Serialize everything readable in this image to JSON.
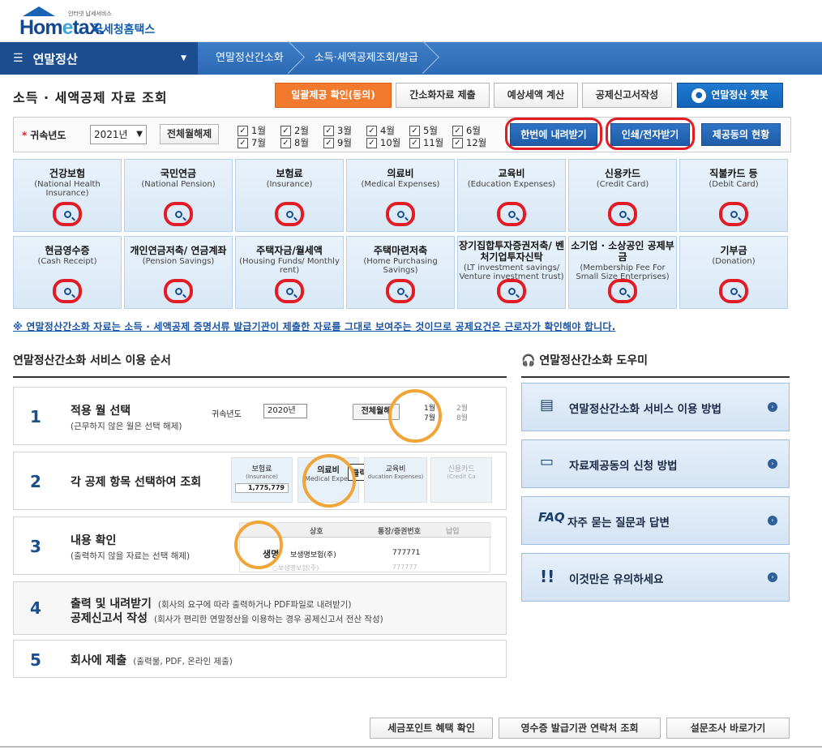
{
  "header": {
    "brand_home": "Hom",
    "brand_e": "e",
    "brand_tax": "tax",
    "tagline": "인터넷 납세서비스",
    "brand_kor": "국세청홈택스"
  },
  "nav": {
    "main": "연말정산",
    "crumbs": [
      "연말정산간소화",
      "소득·세액공제조회/발급"
    ]
  },
  "page": {
    "title": "소득 · 세액공제 자료 조회",
    "top_buttons": [
      "일괄제공 확인(동의)",
      "간소화자료 제출",
      "예상세액 계산",
      "공제신고서작성",
      "연말정산 챗봇"
    ]
  },
  "filter": {
    "year_label": "귀속년도",
    "year_value": "2021년",
    "deselect_all": "전체월해제",
    "months": [
      "1월",
      "2월",
      "3월",
      "4월",
      "5월",
      "6월",
      "7월",
      "8월",
      "9월",
      "10월",
      "11월",
      "12월"
    ],
    "download_all": "한번에 내려받기",
    "print_receive": "인쇄/전자받기",
    "consent_status": "제공동의 현황"
  },
  "categories": [
    {
      "ko": "건강보험",
      "en": "(National Health Insurance)"
    },
    {
      "ko": "국민연금",
      "en": "(National Pension)"
    },
    {
      "ko": "보험료",
      "en": "(Insurance)"
    },
    {
      "ko": "의료비",
      "en": "(Medical Expenses)"
    },
    {
      "ko": "교육비",
      "en": "(Education Expenses)"
    },
    {
      "ko": "신용카드",
      "en": "(Credit Card)"
    },
    {
      "ko": "직불카드 등",
      "en": "(Debit Card)"
    },
    {
      "ko": "현금영수증",
      "en": "(Cash Receipt)"
    },
    {
      "ko": "개인연금저축/ 연금계좌",
      "en": "(Pension Savings)"
    },
    {
      "ko": "주택자금/월세액",
      "en": "(Housing Funds/ Monthly rent)"
    },
    {
      "ko": "주택마련저축",
      "en": "(Home Purchasing Savings)"
    },
    {
      "ko": "장기집합투자증권저축/ 벤처기업투자신탁",
      "en": "(LT investment savings/ Venture investment trust)"
    },
    {
      "ko": "소기업 · 소상공인 공제부금",
      "en": "(Membership Fee For Small Size Enterprises)"
    },
    {
      "ko": "기부금",
      "en": "(Donation)"
    }
  ],
  "notice": "※ 연말정산간소화 자료는 소득 · 세액공제 증명서류 발급기관이 제출한 자료를 그대로 보여주는 것이므로 공제요건은 근로자가 확인해야 합니다.",
  "steps": {
    "title": "연말정산간소화 서비스 이용 순서",
    "items": [
      {
        "num": "1",
        "title": "적용 월 선택",
        "sub": "(근무하지 않은 월은 선택 해제)"
      },
      {
        "num": "2",
        "title": "각 공제 항목 선택하여 조회",
        "sub": ""
      },
      {
        "num": "3",
        "title": "내용 확인",
        "sub": "(출력하지 않을 자료는 선택 해제)"
      },
      {
        "num": "4",
        "title": "출력 및 내려받기",
        "desc": "(회사의 요구에 따라 출력하거나 PDF파일로 내려받기)",
        "title2": "공제신고서 작성",
        "desc2": "(회사가 편리한 연말정산을 이용하는 경우 공제신고서 전산 작성)"
      },
      {
        "num": "5",
        "title": "회사에 제출",
        "desc": "(출력물, PDF, 온라인 제출)"
      }
    ],
    "illus1": {
      "year_label": "귀속년도",
      "year": "2020년",
      "btn": "전체월해",
      "m1": "1월",
      "m2": "2월",
      "m7": "7월",
      "m8": "8월"
    },
    "illus2": {
      "c1": "보험료",
      "c1en": "(Insurance)",
      "c1val": "1,775,779",
      "c2": "의료비",
      "c2en": "Medical Expen",
      "click": "클릭!",
      "c3": "교육비",
      "c3en": "ducation Expenses)",
      "c4": "신용카드",
      "c4en": "(Credit Ca"
    },
    "illus3": {
      "h1": "상호",
      "h2": "통장/증권번호",
      "h3": "납입",
      "r1a": "생명",
      "r1b": "보생명보험(주)",
      "r1c": "777771",
      "r2": "○보생명보험(주)",
      "r2c": "777777"
    }
  },
  "helper": {
    "title": "연말정산간소화 도우미",
    "items": [
      {
        "icon": "document-edit-icon",
        "label": "연말정산간소화 서비스 이용 방법"
      },
      {
        "icon": "document-icon",
        "label": "자료제공동의 신청 방법"
      },
      {
        "icon": "faq-icon",
        "label": "자주 묻는 질문과 답변",
        "prefix": "FAQ"
      },
      {
        "icon": "exclamation-icon",
        "label": "이것만은 유의하세요"
      }
    ]
  },
  "bottom_buttons": [
    "세금포인트 혜택 확인",
    "영수증 발급기관 연락처 조회",
    "설문조사 바로가기"
  ]
}
